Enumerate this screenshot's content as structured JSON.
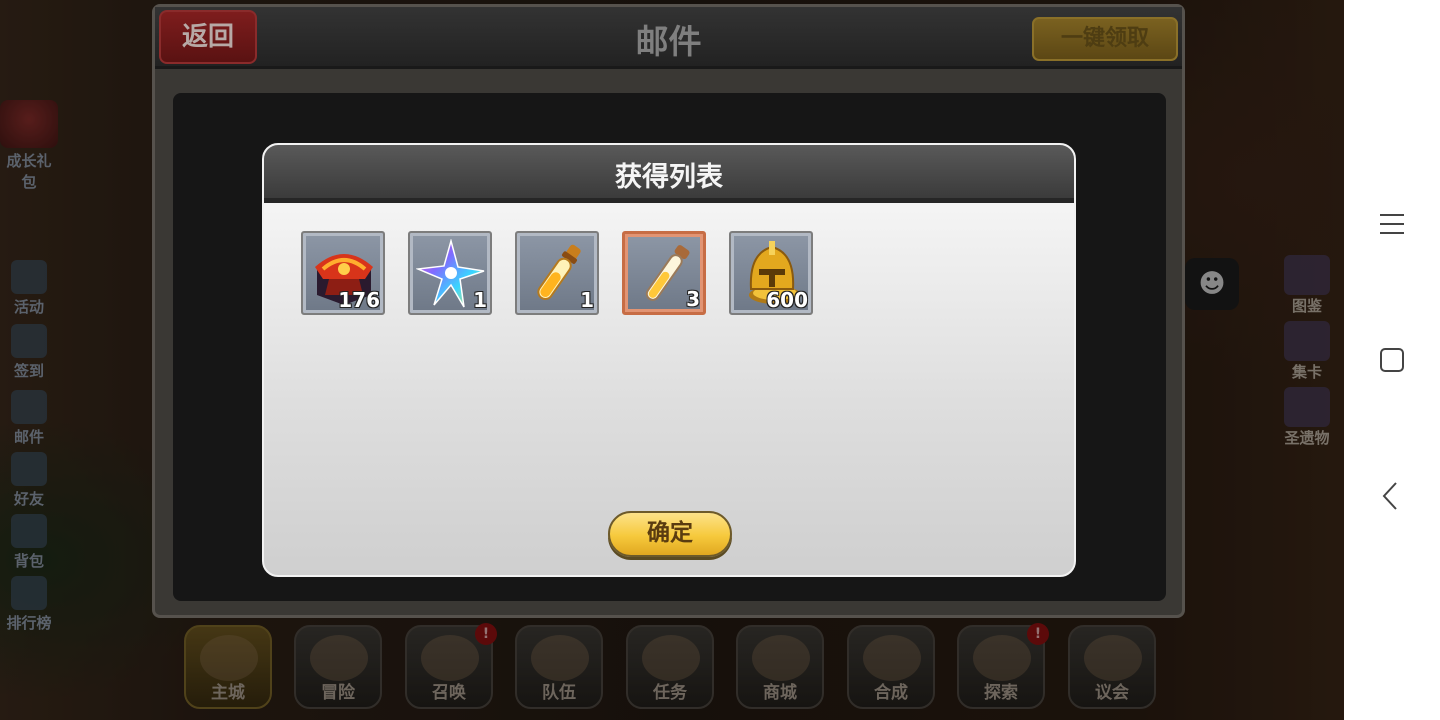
{
  "mail": {
    "back_label": "返回",
    "title": "邮件",
    "claim_all_label": "一键领取"
  },
  "popup": {
    "title": "获得列表",
    "confirm_label": "确定",
    "items": [
      {
        "name": "red-treasure-chest",
        "quantity": "176",
        "selected": false
      },
      {
        "name": "rainbow-star-crystal",
        "quantity": "1",
        "selected": false
      },
      {
        "name": "golden-potion-vial",
        "quantity": "1",
        "selected": false
      },
      {
        "name": "yellow-test-tube-potion",
        "quantity": "3",
        "selected": true
      },
      {
        "name": "golden-helmet-coin",
        "quantity": "600",
        "selected": false
      }
    ]
  },
  "left_menu": {
    "gift_label": "成长礼包",
    "items": [
      "活动",
      "签到",
      "邮件",
      "好友",
      "背包",
      "排行榜"
    ]
  },
  "right_menu": {
    "items": [
      "图鉴",
      "集卡",
      "圣遗物"
    ]
  },
  "bottom_nav": [
    {
      "label": "主城",
      "active": true,
      "badge": ""
    },
    {
      "label": "冒险",
      "active": false,
      "badge": ""
    },
    {
      "label": "召唤",
      "active": false,
      "badge": "!"
    },
    {
      "label": "队伍",
      "active": false,
      "badge": ""
    },
    {
      "label": "任务",
      "active": false,
      "badge": ""
    },
    {
      "label": "商城",
      "active": false,
      "badge": ""
    },
    {
      "label": "合成",
      "active": false,
      "badge": ""
    },
    {
      "label": "探索",
      "active": false,
      "badge": "!"
    },
    {
      "label": "议会",
      "active": false,
      "badge": ""
    }
  ],
  "system_nav": {
    "icons": [
      "menu-icon",
      "home-square-icon",
      "back-chevron-icon"
    ]
  },
  "colors": {
    "confirm_button": "#f6c93c",
    "back_button": "#7e1d1d",
    "claim_all_button": "#7a6120",
    "selected_item_border": "#c76d45"
  }
}
